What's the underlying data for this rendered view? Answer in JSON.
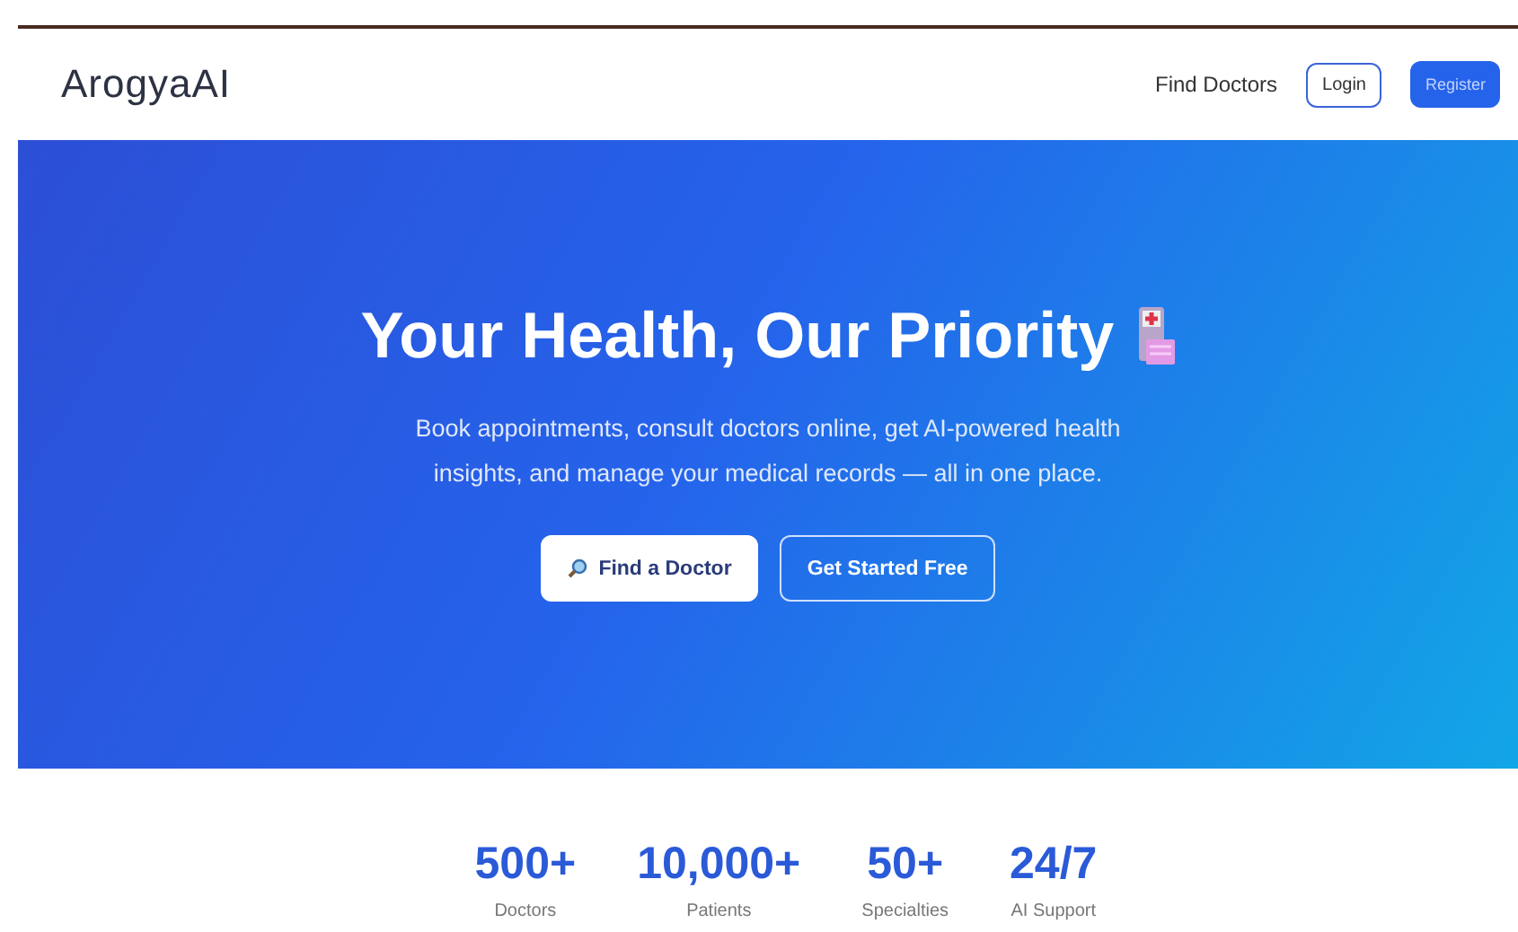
{
  "header": {
    "logo": "ArogyaAI",
    "nav_link": "Find Doctors",
    "login": "Login",
    "register": "Register"
  },
  "hero": {
    "title": "Your Health, Our Priority",
    "subtitle": "Book appointments, consult doctors online, get AI-powered health insights, and manage your medical records — all in one place.",
    "buttons": [
      {
        "label": "Find a Doctor",
        "kind": "primary"
      },
      {
        "label": "Get Started Free",
        "kind": "outline"
      }
    ]
  },
  "stats": [
    {
      "value": "500+",
      "label": "Doctors"
    },
    {
      "value": "10,000+",
      "label": "Patients"
    },
    {
      "value": "50+",
      "label": "Specialties"
    },
    {
      "value": "24/7",
      "label": "AI Support"
    }
  ]
}
